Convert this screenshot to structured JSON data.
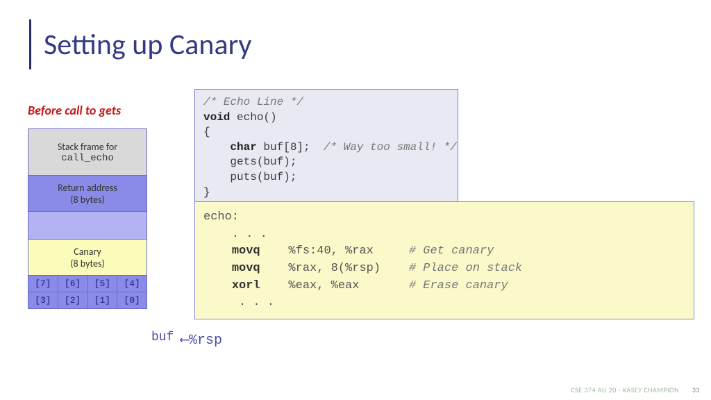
{
  "title": "Setting up Canary",
  "subtitle": "Before call to gets",
  "stack": {
    "frame_label1": "Stack frame for",
    "frame_label2": "call_echo",
    "return_label1": "Return address",
    "return_label2": "(8 bytes)",
    "canary_label1": "Canary",
    "canary_label2": "(8 bytes)",
    "buf_top": [
      "[7]",
      "[6]",
      "[5]",
      "[4]"
    ],
    "buf_bot": [
      "[3]",
      "[2]",
      "[1]",
      "[0]"
    ]
  },
  "buf_label": "buf",
  "rsp_label": "⟵%rsp",
  "code_c": {
    "l1": "/* Echo Line */",
    "l2a": "void",
    "l2b": " echo()",
    "l3": "{",
    "l4a": "    ",
    "l4b": "char",
    "l4c": " buf[8];  ",
    "l4d": "/* Way too small! */",
    "l5": "    gets(buf);",
    "l6": "    puts(buf);",
    "l7": "}"
  },
  "code_asm": {
    "l1": "echo:",
    "l2": "    . . .",
    "l3a": "    ",
    "l3op": "movq",
    "l3b": "    %fs:40, %rax     ",
    "l3c": "# Get canary",
    "l4a": "    ",
    "l4op": "movq",
    "l4b": "    %rax, 8(%rsp)    ",
    "l4c": "# Place on stack",
    "l5a": "    ",
    "l5op": "xorl",
    "l5b": "    %eax, %eax       ",
    "l5c": "# Erase canary",
    "l6": "     . . ."
  },
  "footer": {
    "course": "CSE 374 AU 20 - KASEY CHAMPION",
    "page": "33"
  }
}
